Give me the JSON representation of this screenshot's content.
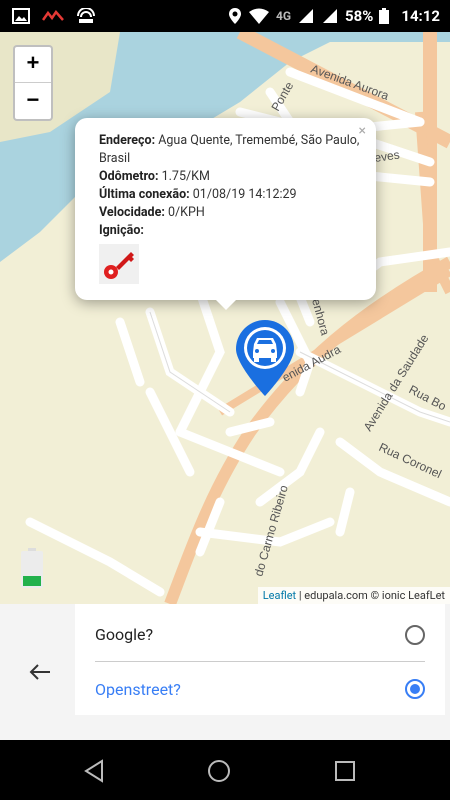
{
  "status_bar": {
    "network": "4G",
    "battery_percent": "58%",
    "time": "14:12"
  },
  "map": {
    "zoom_in_label": "+",
    "zoom_out_label": "−",
    "street_labels": [
      "Avenida Aurora",
      "Ponte",
      "eves",
      "enhora",
      "enida Audra",
      "do Carmo Ribeiro",
      "Avenida da Saudade",
      "Rua Bo",
      "Rua Coronel"
    ],
    "popup": {
      "close_label": "×",
      "address_label": "Endereço:",
      "address_value": "Agua Quente, Tremembé, São Paulo, Brasil",
      "odometer_label": "Odômetro:",
      "odometer_value": "1.75/KM",
      "last_conn_label": "Última conexão:",
      "last_conn_value": "01/08/19 14:12:29",
      "speed_label": "Velocidade:",
      "speed_value": "0/KPH",
      "ignition_label": "Ignição:"
    },
    "attribution": {
      "leaflet": "Leaflet",
      "rest": " | edupala.com © ionic LeafLet"
    }
  },
  "layer_options": {
    "google_label": "Google?",
    "openstreet_label": "Openstreet?",
    "selected": "Openstreet?"
  },
  "colors": {
    "accent": "#387ef5",
    "marker": "#1a6fe0",
    "map_bg": "#f2efd6",
    "water": "#aad3df",
    "major_road": "#f4c79d"
  }
}
